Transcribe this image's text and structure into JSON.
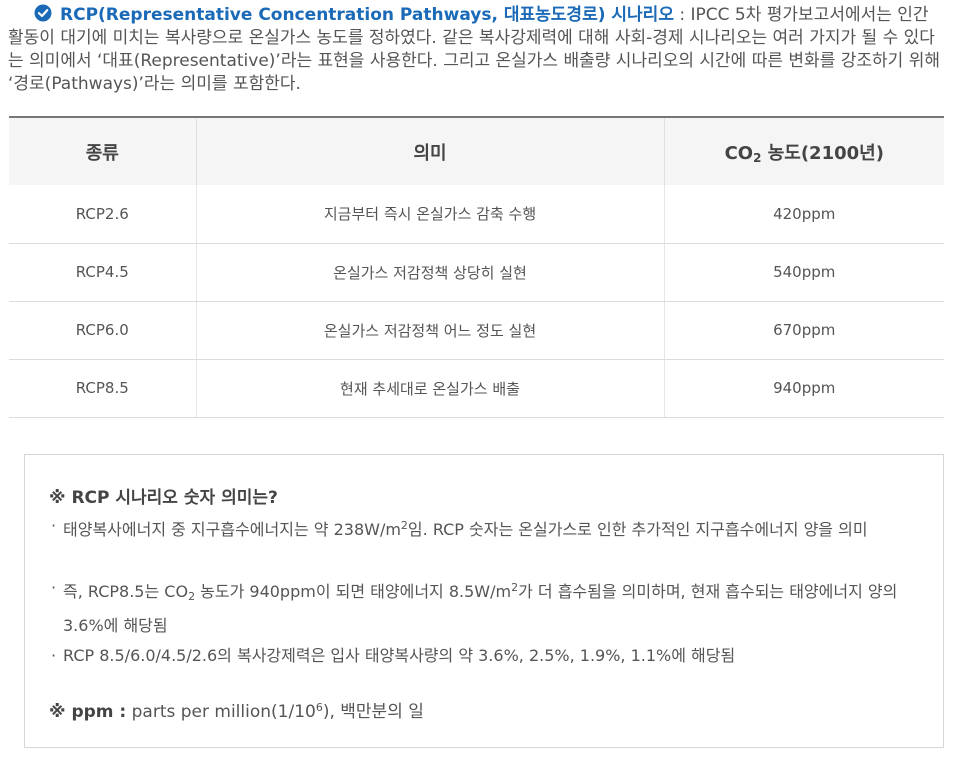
{
  "intro": {
    "title": "RCP(Representative Concentration Pathways, 대표농도경로) 시나리오",
    "body": " : IPCC 5차 평가보고서에서는 인간 활동이 대기에 미치는 복사량으로 온실가스 농도를 정하였다. 같은 복사강제력에 대해 사회-경제 시나리오는 여러 가지가 될 수 있다는 의미에서 ‘대표(Representative)’라는 표현을 사용한다. 그리고 온실가스 배출량 시나리오의 시간에 따른 변화를 강조하기 위해 ‘경로(Pathways)’라는 의미를 포함한다."
  },
  "table": {
    "headers": {
      "type": "종류",
      "meaning": "의미",
      "co2_prefix": "CO",
      "co2_sub": "2",
      "co2_suffix": " 농도(2100년)"
    },
    "rows": [
      {
        "type": "RCP2.6",
        "meaning": "지금부터 즉시 온실가스 감축 수행",
        "co2": "420ppm"
      },
      {
        "type": "RCP4.5",
        "meaning": "온실가스 저감정책 상당히 실현",
        "co2": "540ppm"
      },
      {
        "type": "RCP6.0",
        "meaning": "온실가스 저감정책 어느 정도 실현",
        "co2": "670ppm"
      },
      {
        "type": "RCP8.5",
        "meaning": "현재 추세대로 온실가스 배출",
        "co2": "940ppm"
      }
    ]
  },
  "note": {
    "title": "※ RCP 시나리오 숫자 의미는?",
    "bullet_mark": "·",
    "b1_a": "태양복사에너지 중 지구흡수에너지는 약 238W/m",
    "b1_sup": "2",
    "b1_b": "임. RCP 숫자는 온실가스로 인한 추가적인 지구흡수에너지 양을 의미",
    "b2_a": "즉, RCP8.5는 CO",
    "b2_sub": "2",
    "b2_b": " 농도가 940ppm이 되면 태양에너지 8.5W/m",
    "b2_sup": "2",
    "b2_c": "가 더 흡수됨을 의미하며, 현재 흡수되는 태양에너지 양의 3.6%에 해당됨",
    "b3": "RCP 8.5/6.0/4.5/2.6의 복사강제력은 입사 태양복사량의 약 3.6%, 2.5%, 1.9%, 1.1%에 해당됨",
    "ppm_label": "※ ppm :",
    "ppm_text_a": " parts per million(1/10",
    "ppm_sup": "6",
    "ppm_text_b": "), 백만분의 일"
  },
  "colors": {
    "accent": "#1a6ab8",
    "text": "#555555",
    "header_bg": "#f5f5f5"
  },
  "icons": {
    "title_icon": "check-circle-icon"
  }
}
